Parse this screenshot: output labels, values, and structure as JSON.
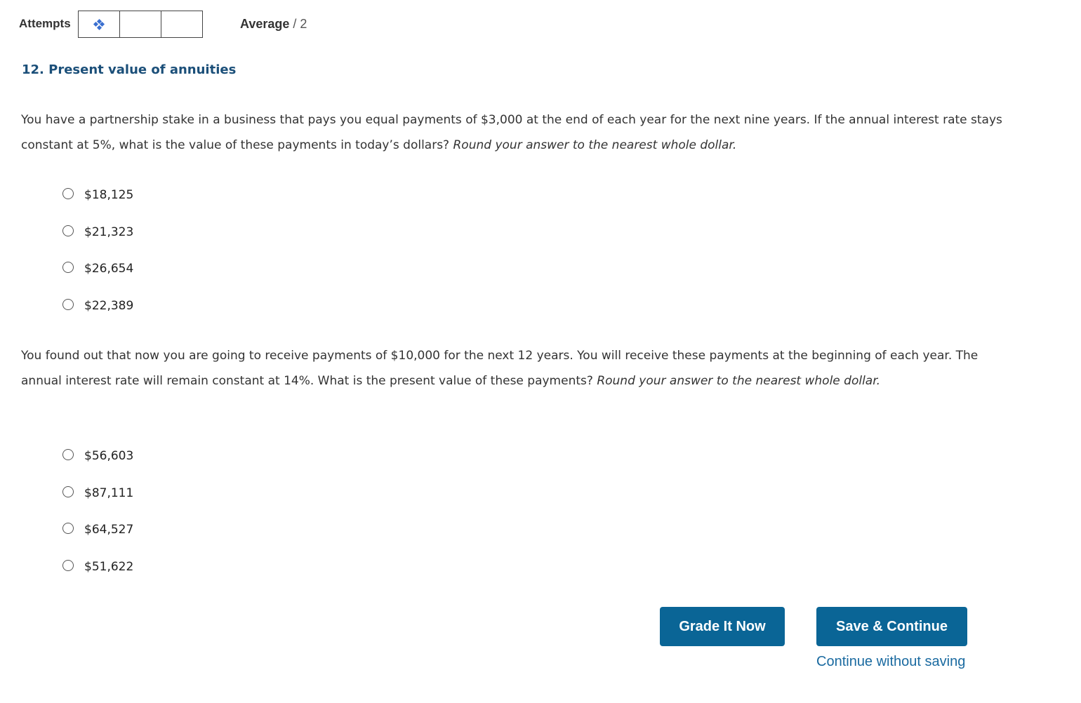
{
  "header": {
    "attempts_label": "Attempts",
    "attempt_slots": [
      {
        "icon": "diamond-loading-icon"
      },
      {
        "icon": ""
      },
      {
        "icon": ""
      }
    ],
    "average_label": "Average",
    "average_value": "/ 2"
  },
  "question": {
    "title": "12. Present value of annuities",
    "parts": [
      {
        "prompt_text": "You have a partnership stake in a business that pays you equal payments of $3,000 at the end of each year for the next nine years. If the annual interest rate stays constant at 5%, what is the value of these payments in today’s dollars? ",
        "prompt_italic": "Round your answer to the nearest whole dollar.",
        "options": [
          "$18,125",
          "$21,323",
          "$26,654",
          "$22,389"
        ]
      },
      {
        "prompt_text": "You found out that now you are going to receive payments of $10,000 for the next 12 years. You will receive these payments at the beginning of each year. The annual interest rate will remain constant at 14%. What is the present value of these payments? ",
        "prompt_italic": "Round your answer to the nearest whole dollar.",
        "options": [
          "$56,603",
          "$87,111",
          "$64,527",
          "$51,622"
        ]
      }
    ]
  },
  "actions": {
    "grade_label": "Grade It Now",
    "save_label": "Save & Continue",
    "continue_label": "Continue without saving"
  },
  "colors": {
    "title": "#1b4f79",
    "button_bg": "#0a6596",
    "link": "#1a6aa0",
    "icon": "#3a6fd0"
  }
}
